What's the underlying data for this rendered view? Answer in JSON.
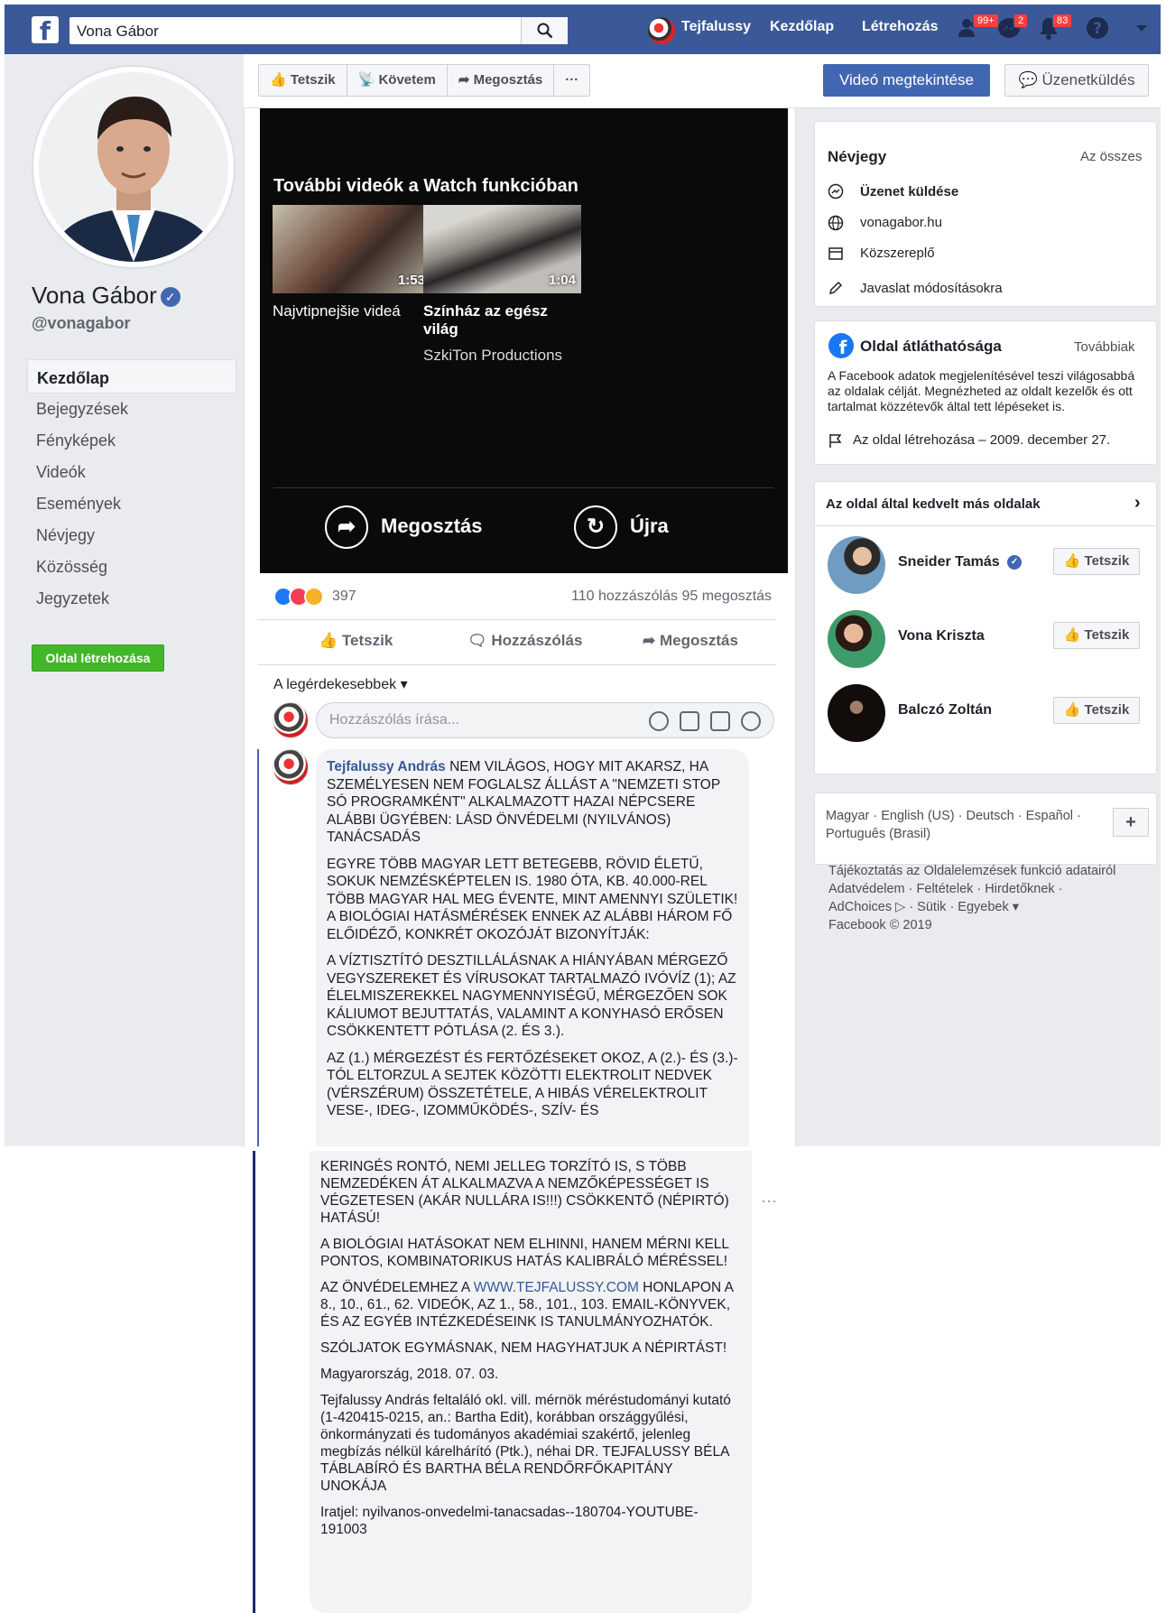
{
  "topbar": {
    "search_value": "Vona Gábor",
    "user_name": "Tejfalussy",
    "nav_home": "Kezdőlap",
    "nav_create": "Létrehozás",
    "badge_friends": "99+",
    "badge_messages": "2",
    "badge_notifications": "83",
    "brand_color": "#3b5998"
  },
  "profile": {
    "name": "Vona Gábor",
    "handle": "@vonagabor",
    "nav": [
      "Kezdőlap",
      "Bejegyzések",
      "Fényképek",
      "Videók",
      "Események",
      "Névjegy",
      "Közösség",
      "Jegyzetek"
    ],
    "create_page": "Oldal létrehozása"
  },
  "actions": {
    "like": "Tetszik",
    "follow": "Követem",
    "share": "Megosztás",
    "more": "···",
    "watch_video": "Videó megtekintése",
    "send_message": "Üzenetküldés"
  },
  "video": {
    "more_title": "További videók a Watch funkcióban",
    "items": [
      {
        "duration": "1:53",
        "title": "Najvtipnejšie videá",
        "channel": ""
      },
      {
        "duration": "1:04",
        "title": "Színház az egész világ",
        "channel": "SzkiTon Productions"
      }
    ],
    "share": "Megosztás",
    "replay": "Újra"
  },
  "post": {
    "reaction_count": "397",
    "comment_stats": "110 hozzászólás  95 megosztás",
    "like": "Tetszik",
    "comment": "Hozzászólás",
    "share": "Megosztás",
    "sort": "A legérdekesebbek",
    "comment_placeholder": "Hozzászólás írása..."
  },
  "comment": {
    "author": "Tejfalussy András",
    "p1": "NEM VILÁGOS, HOGY MIT AKARSZ, HA SZEMÉLYESEN NEM FOGLALSZ ÁLLÁST A \"NEMZETI STOP SÓ PROGRAMKÉNT\" ALKALMAZOTT HAZAI NÉPCSERE ALÁBBI ÜGYÉBEN: LÁSD ÖNVÉDELMI (NYILVÁNOS) TANÁCSADÁS",
    "p2": "EGYRE TÖBB MAGYAR LETT BETEGEBB, RÖVID ÉLETŰ, SOKUK NEMZÉSKÉPTELEN IS. 1980 ÓTA, KB. 40.000-REL TÖBB MAGYAR HAL MEG ÉVENTE, MINT AMENNYI SZÜLETIK! A BIOLÓGIAI HATÁSMÉRÉSEK ENNEK AZ ALÁBBI HÁROM FŐ ELŐIDÉZŐ, KONKRÉT OKOZÓJÁT BIZONYÍTJÁK:",
    "p3": "A VÍZTISZTÍTÓ DESZTILLÁLÁSNAK A HIÁNYÁBAN MÉRGEZŐ VEGYSZEREKET ÉS VÍRUSOKAT TARTALMAZÓ IVÓVÍZ (1); AZ ÉLELMISZEREKKEL NAGYMENNYISÉGŰ, MÉRGEZŐEN SOK KÁLIUMOT BEJUTTATÁS, VALAMINT A KONYHASÓ ERŐSEN CSÖKKENTETT PÓTLÁSA (2. ÉS 3.).",
    "p4": "AZ (1.) MÉRGEZÉST ÉS FERTŐZÉSEKET OKOZ, A (2.)- ÉS (3.)-TÓL ELTORZUL A SEJTEK KÖZÖTTI ELEKTROLIT NEDVEK (VÉRSZÉRUM) ÖSSZETÉTELE, A HIBÁS VÉRELEKTROLIT VESE-, IDEG-, IZOMMŰKÖDÉS-, SZÍV- ÉS",
    "p4b": "KERINGÉS RONTÓ, NEMI JELLEG TORZÍTÓ IS, S TÖBB NEMZEDÉKEN ÁT ALKALMAZVA A NEMZŐKÉPESSÉGET IS VÉGZETESEN (AKÁR NULLÁRA IS!!!) CSÖKKENTŐ (NÉPIRTÓ) HATÁSÚ!",
    "p5a": "A BIOLÓGIAI HATÁSOKAT NEM ELHINNI, HANEM MÉRNI KELL",
    "p5b": "PONTOS, KOMBINATORIKUS HATÁS KALIBRÁLÓ MÉRÉSSEL!",
    "p6a": "AZ ÖNVÉDELEMHEZ A",
    "p6link": "WWW.TEJFALUSSY.COM",
    "p6b": "HONLAPON A 8., 10., 61., 62. VIDEÓK, AZ 1., 58., 101., 103. EMAIL-KÖNYVEK, ÉS AZ EGYÉB INTÉZKEDÉSEINK IS TANULMÁNYOZHATÓK.",
    "p7": "SZÓLJATOK EGYMÁSNAK, NEM HAGYHATJUK A NÉPIRTÁST!",
    "p8": "Magyarország, 2018. 07. 03.",
    "p9": "Tejfalussy András feltaláló okl. vill. mérnök méréstudományi kutató (1-420415-0215, an.: Bartha Edit), korábban országgyűlési, önkormányzati és tudományos akadémiai szakértő, jelenleg megbízás nélkül kárelhárító (Ptk.), néhai DR. TEJFALUSSY BÉLA TÁBLABÍRÓ ÉS BARTHA BÉLA RENDŐRFŐKAPITÁNY UNOKÁJA",
    "p10": "Iratjel: nyilvanos-onvedelmi-tanacsadas--180704-YOUTUBE-191003"
  },
  "about": {
    "title": "Névjegy",
    "see_all": "Az összes",
    "rows": [
      "Üzenet küldése",
      "vonagabor.hu",
      "Közszereplő",
      "Javaslat módosításokra"
    ]
  },
  "transparency": {
    "title": "Oldal átláthatósága",
    "more": "Továbbiak",
    "text": "A Facebook adatok megjelenítésével teszi világosabbá az oldalak célját. Megnézheted az oldalt kezelők és ott tartalmat közzétevők által tett lépéseket is.",
    "created": "Az oldal létrehozása – 2009. december 27."
  },
  "liked_pages": {
    "title": "Az oldal által kedvelt más oldalak",
    "items": [
      {
        "name": "Sneider Tamás",
        "button": "Tetszik"
      },
      {
        "name": "Vona Kriszta",
        "button": "Tetszik"
      },
      {
        "name": "Balczó Zoltán",
        "button": "Tetszik"
      }
    ]
  },
  "languages": {
    "line1": "Magyar · English (US) · Deutsch · Español ·",
    "line2": "Português (Brasil)",
    "add": "+"
  },
  "footer": {
    "l1": "Tájékoztatás az Oldalelemzések funkció adatairól",
    "l2": "Adatvédelem · Feltételek · Hirdetőknek ·",
    "l3": "AdChoices ▷ · Sütik · Egyebek ▾",
    "l4": "Facebook © 2019"
  }
}
